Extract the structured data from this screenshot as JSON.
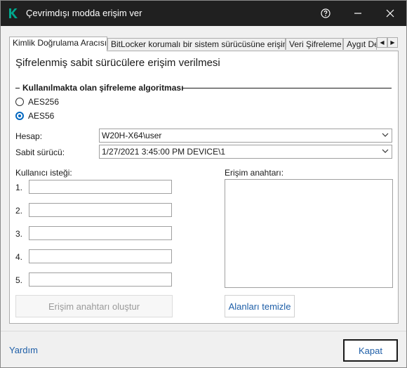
{
  "window": {
    "title": "Çevrimdışı modda erişim ver",
    "accent_color": "#00a88e",
    "titlebar_color": "#202020",
    "controls": [
      "help-icon",
      "minimize-icon",
      "close-icon"
    ]
  },
  "tabs": [
    {
      "label": "Kimlik Doğrulama Aracısı",
      "active": true
    },
    {
      "label": "BitLocker korumalı bir sistem sürücüsüne erişim",
      "active": false
    },
    {
      "label": "Veri Şifreleme",
      "active": false
    },
    {
      "label": "Aygıt De",
      "active": false
    }
  ],
  "tab_scroll": {
    "left": "◀",
    "right": "▶"
  },
  "heading": "Şifrelenmiş sabit sürücülere erişim verilmesi",
  "algorithm_group": {
    "title": "Kullanılmakta olan şifreleme algoritması",
    "options": [
      {
        "label": "AES256",
        "checked": false
      },
      {
        "label": "AES56",
        "checked": true
      }
    ]
  },
  "fields": {
    "account_label": "Hesap:",
    "account_value": "W20H-X64\\user",
    "drive_label": "Sabit sürücü:",
    "drive_value": "1/27/2021 3:45:00 PM  DEVICE\\1"
  },
  "user_request": {
    "label": "Kullanıcı isteği:",
    "rows": [
      "1.",
      "2.",
      "3.",
      "4.",
      "5."
    ]
  },
  "access_key": {
    "label": "Erişim anahtarı:"
  },
  "buttons": {
    "generate": "Erişim anahtarı oluştur",
    "clear": "Alanları temizle",
    "close": "Kapat"
  },
  "footer": {
    "help": "Yardım"
  }
}
